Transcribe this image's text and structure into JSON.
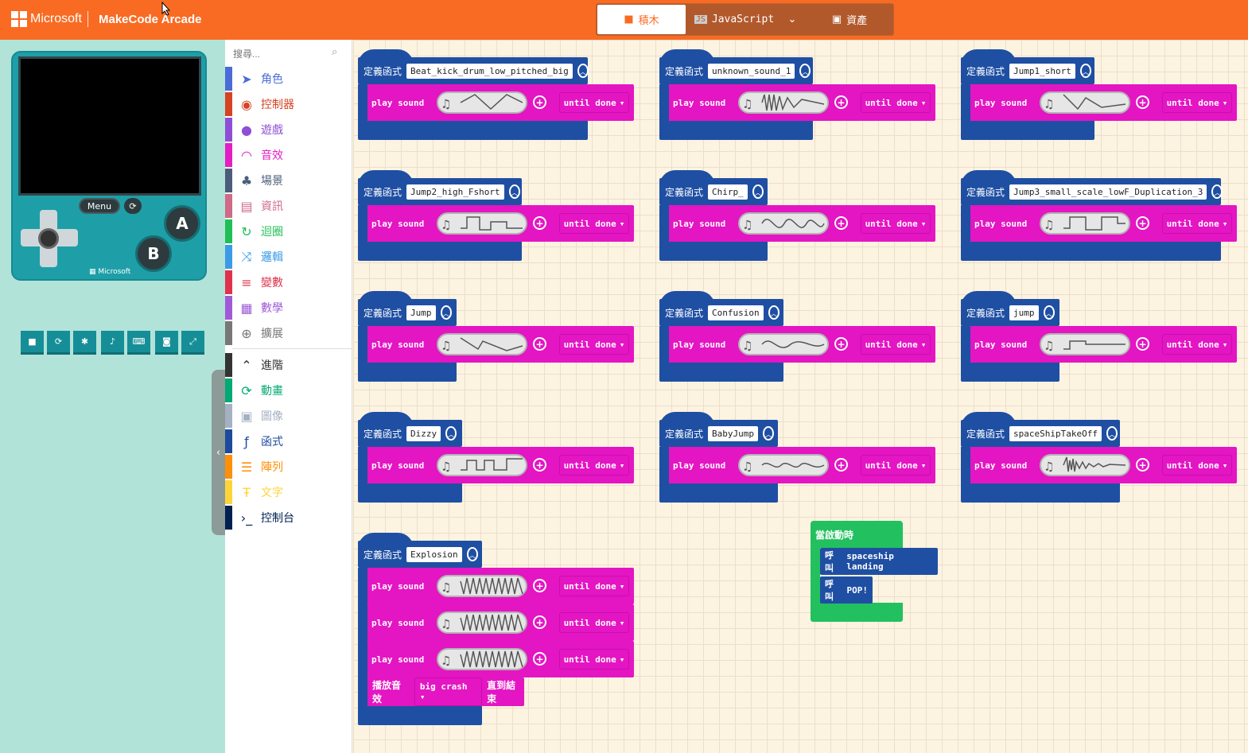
{
  "header": {
    "brand": "Microsoft",
    "app_title": "MakeCode Arcade",
    "tabs": [
      {
        "label": "積木",
        "icon": "puzzle-icon"
      },
      {
        "label": "JavaScript",
        "icon": "js-icon"
      },
      {
        "label": "",
        "icon": "chevron-down-icon"
      },
      {
        "label": "資產",
        "icon": "image-icon"
      }
    ]
  },
  "simulator": {
    "menu_label": "Menu",
    "a_label": "A",
    "b_label": "B",
    "brand": "Microsoft",
    "toolbar": [
      "stop-icon",
      "restart-icon",
      "debug-icon",
      "sound-icon",
      "keyboard-icon",
      "screenshot-icon",
      "fullscreen-icon"
    ]
  },
  "toolbox": {
    "search_placeholder": "搜尋...",
    "categories": [
      {
        "label": "角色",
        "color": "#4b6cd7",
        "icon": "paper-plane-icon"
      },
      {
        "label": "控制器",
        "color": "#d54322",
        "icon": "gamepad-icon"
      },
      {
        "label": "遊戲",
        "color": "#8f4fd5",
        "icon": "circle-icon"
      },
      {
        "label": "音效",
        "color": "#e41ec4",
        "icon": "headphones-icon"
      },
      {
        "label": "場景",
        "color": "#4b5d7a",
        "icon": "tree-icon"
      },
      {
        "label": "資訊",
        "color": "#cf6a87",
        "icon": "id-card-icon"
      },
      {
        "label": "迴圈",
        "color": "#20bf55",
        "icon": "loop-icon"
      },
      {
        "label": "邏輯",
        "color": "#3b9be6",
        "icon": "shuffle-icon"
      },
      {
        "label": "變數",
        "color": "#e0324d",
        "icon": "list-icon"
      },
      {
        "label": "數學",
        "color": "#a05ad8",
        "icon": "calculator-icon"
      },
      {
        "label": "擴展",
        "color": "#777777",
        "icon": "plus-circle-icon"
      },
      {
        "label": "進階",
        "color": "#333333",
        "icon": "chevron-up-icon"
      },
      {
        "label": "動畫",
        "color": "#03aa74",
        "icon": "refresh-icon"
      },
      {
        "label": "圖像",
        "color": "#a5b1c2",
        "icon": "image-icon"
      },
      {
        "label": "函式",
        "color": "#1e4a9c",
        "icon": "function-icon"
      },
      {
        "label": "陣列",
        "color": "#ff8f08",
        "icon": "array-icon"
      },
      {
        "label": "文字",
        "color": "#ffd43a",
        "icon": "text-icon"
      },
      {
        "label": "控制台",
        "color": "#002050",
        "icon": "console-icon"
      }
    ]
  },
  "blocks": {
    "define_label": "定義函式",
    "play_label": "play sound",
    "until_label": "until done",
    "functions": [
      {
        "name": "Beat_kick_drum_low_pitched_big",
        "plays": 1
      },
      {
        "name": "unknown_sound_1",
        "plays": 1
      },
      {
        "name": "Jump1_short",
        "plays": 1
      },
      {
        "name": "Jump2_high_Fshort",
        "plays": 1
      },
      {
        "name": "Chirp_",
        "plays": 1
      },
      {
        "name": "Jump3_small_scale_lowF_Duplication_3",
        "plays": 1
      },
      {
        "name": "Jump",
        "plays": 1
      },
      {
        "name": "Confusion",
        "plays": 1
      },
      {
        "name": "jump",
        "plays": 1
      },
      {
        "name": "Dizzy",
        "plays": 1
      },
      {
        "name": "BabyJump",
        "plays": 1
      },
      {
        "name": "spaceShipTakeOff",
        "plays": 1
      },
      {
        "name": "Explosion",
        "plays": 3
      }
    ],
    "effect": {
      "prefix": "播放音效",
      "value": "big crash",
      "suffix": "直到結束"
    },
    "event": {
      "label": "當啟動時",
      "calls": [
        {
          "prefix": "呼叫",
          "name": "spaceship landing"
        },
        {
          "prefix": "呼叫",
          "name": "POP!"
        }
      ]
    }
  }
}
